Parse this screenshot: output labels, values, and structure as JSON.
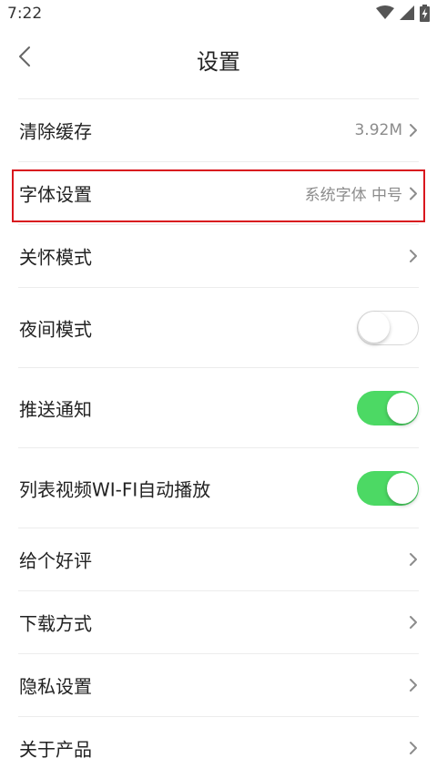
{
  "status_bar": {
    "time": "7:22",
    "icons": [
      "wifi-icon",
      "cell-signal-icon",
      "battery-charging-icon"
    ]
  },
  "header": {
    "back_icon": "chevron-left-icon",
    "title": "设置"
  },
  "settings": {
    "clear_cache": {
      "label": "清除缓存",
      "value": "3.92M"
    },
    "font_settings": {
      "label": "字体设置",
      "value": "系统字体 中号"
    },
    "care_mode": {
      "label": "关怀模式"
    },
    "night_mode": {
      "label": "夜间模式",
      "enabled": false
    },
    "push_notify": {
      "label": "推送通知",
      "enabled": true
    },
    "wifi_autoplay": {
      "label": "列表视频WI-FI自动播放",
      "enabled": true
    },
    "rate_us": {
      "label": "给个好评"
    },
    "download_method": {
      "label": "下载方式"
    },
    "privacy_settings": {
      "label": "隐私设置"
    },
    "about_product": {
      "label": "关于产品"
    }
  },
  "colors": {
    "toggle_on": "#4cd964",
    "highlight_border": "#d9171e",
    "secondary_text": "#8c8c8c"
  }
}
